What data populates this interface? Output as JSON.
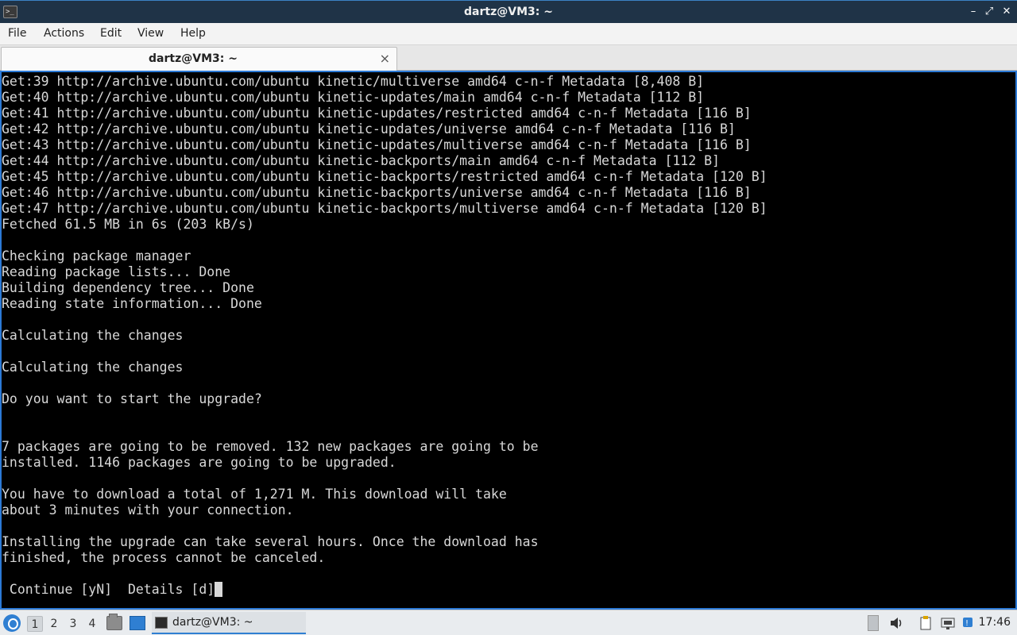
{
  "window": {
    "title": "dartz@VM3: ~",
    "icon": "terminal-icon",
    "minimize_glyph": "–",
    "maximize_glyph": "⤢",
    "close_glyph": "✕"
  },
  "menu": {
    "file": "File",
    "actions": "Actions",
    "edit": "Edit",
    "view": "View",
    "help": "Help"
  },
  "tab": {
    "label": "dartz@VM3: ~",
    "close_glyph": "×"
  },
  "terminal": {
    "lines": [
      "Get:39 http://archive.ubuntu.com/ubuntu kinetic/multiverse amd64 c-n-f Metadata [8,408 B]",
      "Get:40 http://archive.ubuntu.com/ubuntu kinetic-updates/main amd64 c-n-f Metadata [112 B]",
      "Get:41 http://archive.ubuntu.com/ubuntu kinetic-updates/restricted amd64 c-n-f Metadata [116 B]",
      "Get:42 http://archive.ubuntu.com/ubuntu kinetic-updates/universe amd64 c-n-f Metadata [116 B]",
      "Get:43 http://archive.ubuntu.com/ubuntu kinetic-updates/multiverse amd64 c-n-f Metadata [116 B]",
      "Get:44 http://archive.ubuntu.com/ubuntu kinetic-backports/main amd64 c-n-f Metadata [112 B]",
      "Get:45 http://archive.ubuntu.com/ubuntu kinetic-backports/restricted amd64 c-n-f Metadata [120 B]",
      "Get:46 http://archive.ubuntu.com/ubuntu kinetic-backports/universe amd64 c-n-f Metadata [116 B]",
      "Get:47 http://archive.ubuntu.com/ubuntu kinetic-backports/multiverse amd64 c-n-f Metadata [120 B]",
      "Fetched 61.5 MB in 6s (203 kB/s)",
      "",
      "Checking package manager",
      "Reading package lists... Done",
      "Building dependency tree... Done",
      "Reading state information... Done",
      "",
      "Calculating the changes",
      "",
      "Calculating the changes",
      "",
      "Do you want to start the upgrade?",
      "",
      "",
      "7 packages are going to be removed. 132 new packages are going to be",
      "installed. 1146 packages are going to be upgraded.",
      "",
      "You have to download a total of 1,271 M. This download will take",
      "about 3 minutes with your connection.",
      "",
      "Installing the upgrade can take several hours. Once the download has",
      "finished, the process cannot be canceled.",
      ""
    ],
    "prompt": " Continue [yN]  Details [d]"
  },
  "taskbar": {
    "workspaces": [
      "1",
      "2",
      "3",
      "4"
    ],
    "active_workspace": "1",
    "task_label": "dartz@VM3: ~",
    "clock": "17:46"
  },
  "colors": {
    "titlebar_bg": "#1f3347",
    "terminal_bg": "#000000",
    "terminal_fg": "#d8d8d8",
    "accent": "#2f7fd2"
  }
}
